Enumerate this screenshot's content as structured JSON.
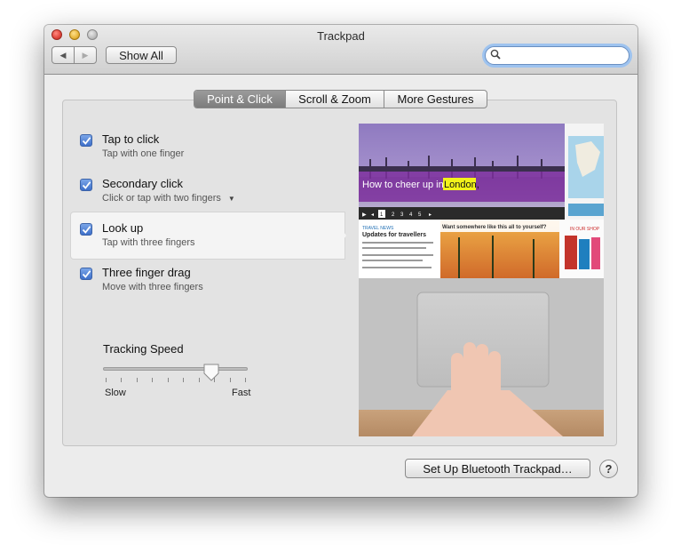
{
  "window": {
    "title": "Trackpad"
  },
  "toolbar": {
    "back_icon": "◀",
    "forward_icon": "▶",
    "show_all_label": "Show All",
    "search_value": "",
    "search_placeholder": ""
  },
  "tabs": [
    {
      "label": "Point & Click",
      "selected": true
    },
    {
      "label": "Scroll & Zoom",
      "selected": false
    },
    {
      "label": "More Gestures",
      "selected": false
    }
  ],
  "options": [
    {
      "label": "Tap to click",
      "sub": "Tap with one finger",
      "checked": true
    },
    {
      "label": "Secondary click",
      "sub": "Click or tap with two fingers",
      "checked": true,
      "has_dropdown": true
    },
    {
      "label": "Look up",
      "sub": "Tap with three fingers",
      "checked": true,
      "selected": true
    },
    {
      "label": "Three finger drag",
      "sub": "Move with three fingers",
      "checked": true
    }
  ],
  "tracking_speed": {
    "label": "Tracking Speed",
    "min_label": "Slow",
    "max_label": "Fast",
    "value": 0.75
  },
  "preview": {
    "headline_pre": "How to cheer up in ",
    "headline_highlight": "London,",
    "pages": [
      "1",
      "2",
      "3",
      "4",
      "5"
    ],
    "news_header": "TRAVEL NEWS",
    "news_title": "Updates for travellers",
    "promo": "Want somewhere like this all to yourself?",
    "sidebar_header": "IN OUR SHOP"
  },
  "footer": {
    "bluetooth_label": "Set Up Bluetooth Trackpad…",
    "help_label": "?"
  },
  "colors": {
    "checkbox": "#3d6fc9",
    "search_focus": "#9ec3ef",
    "selected_tab": "#7c7c7c"
  }
}
